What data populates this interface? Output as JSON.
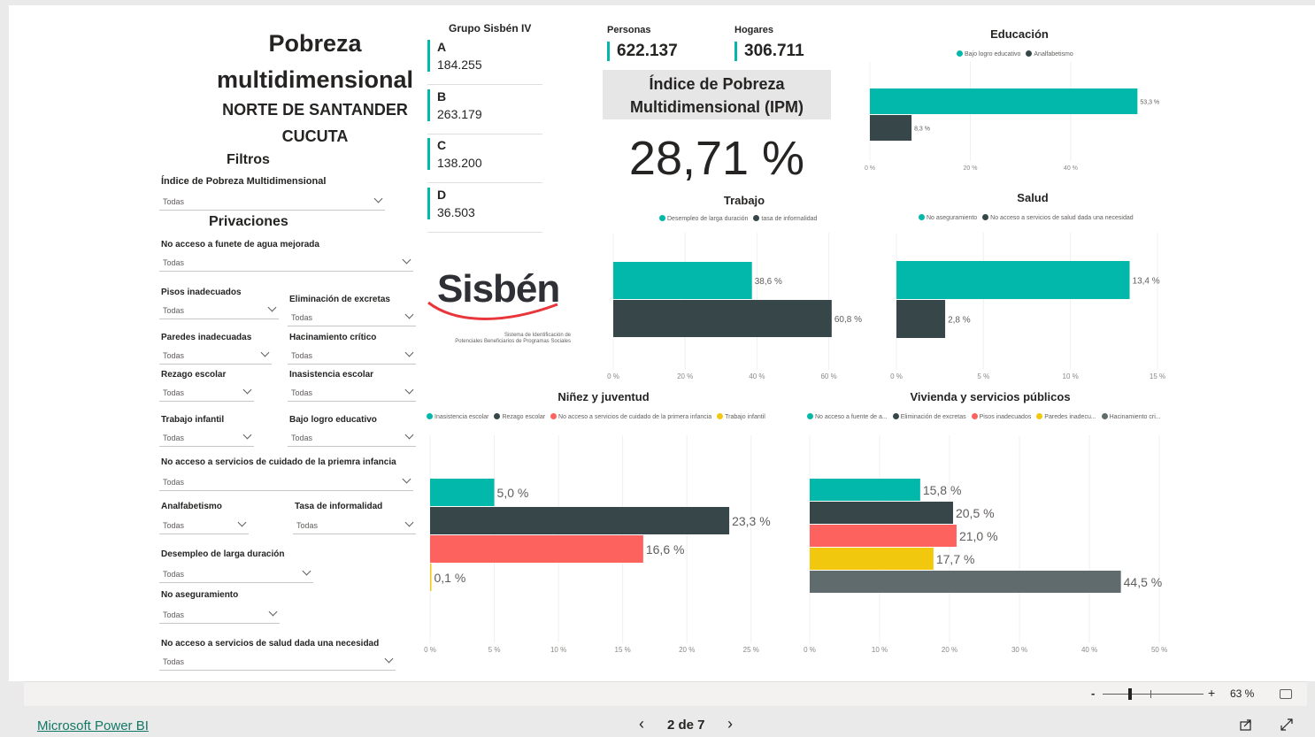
{
  "header": {
    "title_line1": "Pobreza",
    "title_line2": "multidimensional",
    "department": "NORTE DE SANTANDER",
    "municipality": "CUCUTA"
  },
  "filters": {
    "heading": "Filtros",
    "ipm_label": "Índice de Pobreza Multidimensional",
    "ipm_value": "Todas",
    "privaciones_heading": "Privaciones",
    "agua_label": "No acceso a funete de agua mejorada",
    "agua_value": "Todas",
    "pisos_label": "Pisos inadecuados",
    "pisos_value": "Todas",
    "excretas_label": "Eliminación de excretas",
    "excretas_value": "Todas",
    "paredes_label": "Paredes inadecuadas",
    "paredes_value": "Todas",
    "hacinamiento_label": "Hacinamiento crítico",
    "hacinamiento_value": "Todas",
    "rezago_label": "Rezago escolar",
    "rezago_value": "Todas",
    "inasistencia_label": "Inasistencia escolar",
    "inasistencia_value": "Todas",
    "trabajo_infantil_label": "Trabajo infantil",
    "trabajo_infantil_value": "Todas",
    "bajo_logro_label": "Bajo logro educativo",
    "bajo_logro_value": "Todas",
    "primera_infancia_label": "No acceso a servicios de cuidado de la priemra infancia",
    "primera_infancia_value": "Todas",
    "analfabetismo_label": "Analfabetismo",
    "analfabetismo_value": "Todas",
    "informalidad_label": "Tasa de informalidad",
    "informalidad_value": "Todas",
    "desempleo_label": "Desempleo de larga duración",
    "desempleo_value": "Todas",
    "aseguramiento_label": "No aseguramiento",
    "aseguramiento_value": "Todas",
    "salud_label": "No acceso a servicios de salud dada una necesidad",
    "salud_value": "Todas"
  },
  "grupo": {
    "title": "Grupo Sisbén IV",
    "items": [
      {
        "key": "A",
        "value": "184.255"
      },
      {
        "key": "B",
        "value": "263.179"
      },
      {
        "key": "C",
        "value": "138.200"
      },
      {
        "key": "D",
        "value": "36.503"
      }
    ]
  },
  "kpis": {
    "personas_label": "Personas",
    "personas_value": "622.137",
    "hogares_label": "Hogares",
    "hogares_value": "306.711",
    "ipm_title_line1": "Índice de Pobreza",
    "ipm_title_line2": "Multidimensional (IPM)",
    "ipm_value": "28,71 %"
  },
  "logo": {
    "text": "Sisbén",
    "caption_line1": "Sistema de Identificación de",
    "caption_line2": "Potenciales Beneficiarios de Programas Sociales"
  },
  "colors": {
    "teal": "#01b8aa",
    "dark": "#374649",
    "red": "#fd625e",
    "yellow": "#f2c80f",
    "gray": "#5f6b6d"
  },
  "chart_data": [
    {
      "type": "bar",
      "title": "Educación",
      "series": [
        {
          "name": "Bajo logro educativo",
          "values": [
            53.3
          ]
        },
        {
          "name": "Analfabetismo",
          "values": [
            8.3
          ]
        }
      ],
      "value_labels": [
        "53,3 %",
        "8,3 %"
      ],
      "ticks": [
        "0 %",
        "20 %",
        "40 %"
      ],
      "xlim": [
        0,
        55
      ]
    },
    {
      "type": "bar",
      "title": "Trabajo",
      "series": [
        {
          "name": "Desempleo de larga duración",
          "values": [
            38.6
          ]
        },
        {
          "name": "tasa de informalidad",
          "values": [
            60.8
          ]
        }
      ],
      "value_labels": [
        "38,6 %",
        "60,8 %"
      ],
      "ticks": [
        "0 %",
        "20 %",
        "40 %",
        "60 %"
      ],
      "xlim": [
        0,
        67
      ]
    },
    {
      "type": "bar",
      "title": "Salud",
      "series": [
        {
          "name": "No aseguramiento",
          "values": [
            13.4
          ]
        },
        {
          "name": "No acceso a servicios de salud dada una necesidad",
          "values": [
            2.8
          ]
        }
      ],
      "value_labels": [
        "13,4 %",
        "2,8 %"
      ],
      "ticks": [
        "0 %",
        "5 %",
        "10 %",
        "15 %"
      ],
      "xlim": [
        0,
        15
      ]
    },
    {
      "type": "bar",
      "title": "Niñez y juventud",
      "series": [
        {
          "name": "Inasistencia escolar",
          "values": [
            5.0
          ]
        },
        {
          "name": "Rezago escolar",
          "values": [
            23.3
          ]
        },
        {
          "name": "No acceso a servicios de cuidado de la primera infancia",
          "values": [
            16.6
          ]
        },
        {
          "name": "Trabajo infantil",
          "values": [
            0.1
          ]
        }
      ],
      "value_labels": [
        "5,0 %",
        "23,3 %",
        "16,6 %",
        "0,1 %"
      ],
      "ticks": [
        "0 %",
        "5 %",
        "10 %",
        "15 %",
        "20 %",
        "25 %"
      ],
      "xlim": [
        0,
        25.5
      ]
    },
    {
      "type": "bar",
      "title": "Vivienda y servicios públicos",
      "series": [
        {
          "name": "No acceso a fuente de a...",
          "values": [
            15.8
          ]
        },
        {
          "name": "Eliminación de excretas",
          "values": [
            20.5
          ]
        },
        {
          "name": "Pisos inadecuados",
          "values": [
            21.0
          ]
        },
        {
          "name": "Paredes inadecu...",
          "values": [
            17.7
          ]
        },
        {
          "name": "Hacinamiento cri...",
          "values": [
            44.5
          ]
        }
      ],
      "value_labels": [
        "15,8 %",
        "20,5 %",
        "21,0 %",
        "17,7 %",
        "44,5 %"
      ],
      "ticks": [
        "0 %",
        "10 %",
        "20 %",
        "30 %",
        "40 %",
        "50 %"
      ],
      "xlim": [
        0,
        51
      ]
    }
  ],
  "footer": {
    "zoom_minus": "-",
    "zoom_plus": "+",
    "zoom_level": "63 %",
    "brand_link": "Microsoft Power BI",
    "page_indicator": "2 de 7",
    "prev": "‹",
    "next": "›"
  }
}
